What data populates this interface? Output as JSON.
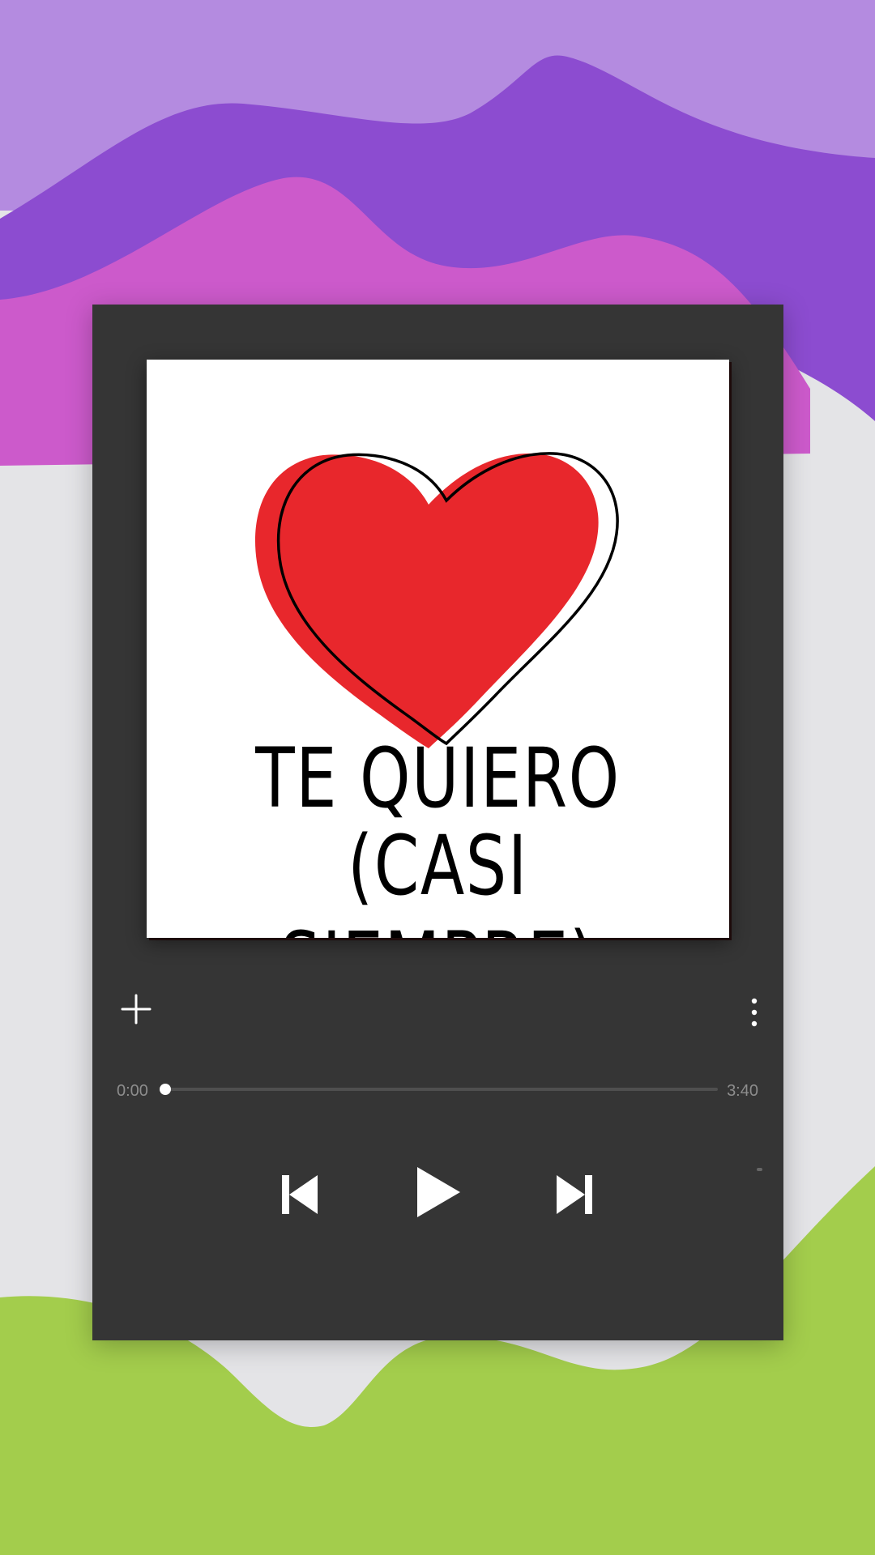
{
  "album": {
    "cover_line1": "TE QUIERO",
    "cover_line2": "(CASI SIEMPRE)"
  },
  "player": {
    "current_time": "0:00",
    "total_time": "3:40",
    "progress": 0.0
  },
  "icons": {
    "add": "plus-icon",
    "more": "more-vertical-icon",
    "previous": "skip-previous-icon",
    "play": "play-icon",
    "next": "skip-next-icon"
  },
  "colors": {
    "panel": "#353535",
    "heart": "#e8272c",
    "wave_lavender": "#b48be0",
    "wave_purple": "#8c4cd0",
    "wave_magenta": "#cc5acb",
    "wave_green": "#a3cd4c",
    "background": "#e4e4e7"
  }
}
